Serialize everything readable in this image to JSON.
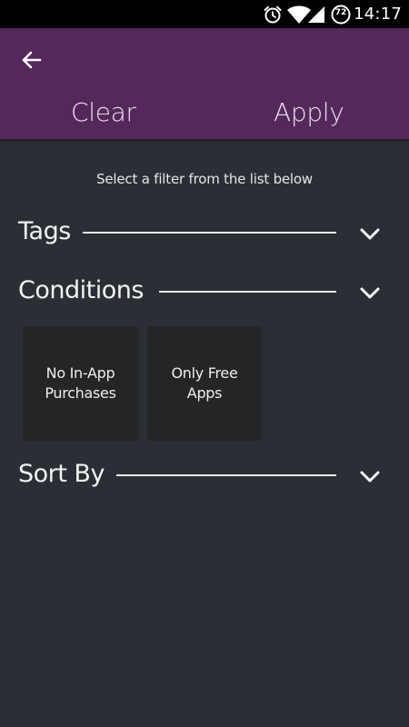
{
  "status_bar": {
    "time": "14:17",
    "battery_level": "72",
    "icons": [
      "alarm-icon",
      "wifi-icon",
      "signal-icon",
      "battery-icon"
    ]
  },
  "toolbar": {
    "back_icon": "arrow-left-icon",
    "clear_label": "Clear",
    "apply_label": "Apply",
    "background": "#55285b"
  },
  "hint": "Select a filter from the list below",
  "sections": {
    "tags": {
      "title": "Tags",
      "expanded": false
    },
    "conditions": {
      "title": "Conditions",
      "expanded": true,
      "options": [
        {
          "label": "No In-App Purchases"
        },
        {
          "label": "Only Free Apps"
        }
      ]
    },
    "sort_by": {
      "title": "Sort By",
      "expanded": false
    }
  },
  "colors": {
    "background": "#2b2f35",
    "tile": "#232527",
    "accent": "#55285b"
  }
}
